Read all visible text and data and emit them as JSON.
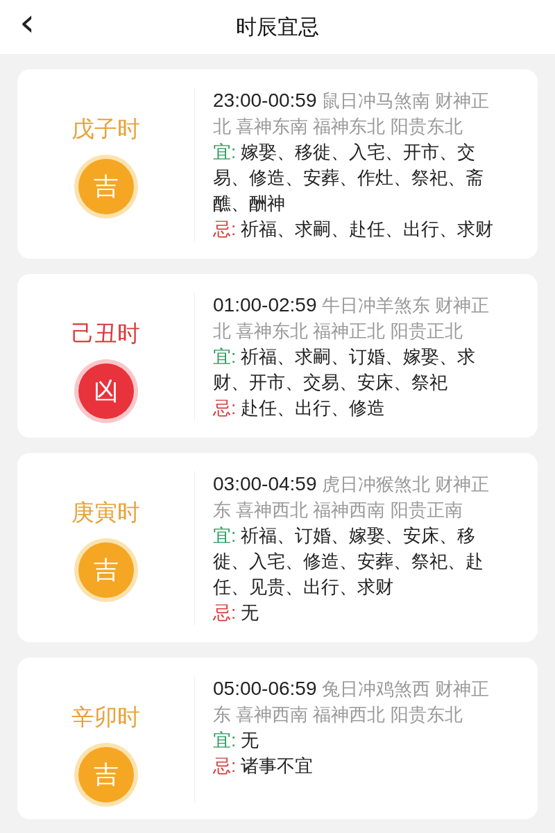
{
  "header": {
    "back_icon": "‹",
    "title": "时辰宜忌"
  },
  "hours": [
    {
      "name": "戊子时",
      "unlucky": false,
      "badge": "吉",
      "time": "23:00-00:59",
      "info": "鼠日冲马煞南 财神正北 喜神东南 福神东北 阳贵东北",
      "yi_label": "宜:",
      "yi": "嫁娶、移徙、入宅、开市、交易、修造、安葬、作灶、祭祀、斋醮、酬神",
      "ji_label": "忌:",
      "ji": "祈福、求嗣、赴任、出行、求财"
    },
    {
      "name": "己丑时",
      "unlucky": true,
      "badge": "凶",
      "time": "01:00-02:59",
      "info": "牛日冲羊煞东 财神正北 喜神东北 福神正北 阳贵正北",
      "yi_label": "宜:",
      "yi": "祈福、求嗣、订婚、嫁娶、求财、开市、交易、安床、祭祀",
      "ji_label": "忌:",
      "ji": "赴任、出行、修造"
    },
    {
      "name": "庚寅时",
      "unlucky": false,
      "badge": "吉",
      "time": "03:00-04:59",
      "info": "虎日冲猴煞北 财神正东 喜神西北 福神西南 阳贵正南",
      "yi_label": "宜:",
      "yi": "祈福、订婚、嫁娶、安床、移徙、入宅、修造、安葬、祭祀、赴任、见贵、出行、求财",
      "ji_label": "忌:",
      "ji": "无"
    },
    {
      "name": "辛卯时",
      "unlucky": false,
      "badge": "吉",
      "time": "05:00-06:59",
      "info": "兔日冲鸡煞西 财神正东 喜神西南 福神西北 阳贵东北",
      "yi_label": "宜:",
      "yi": "无",
      "ji_label": "忌:",
      "ji": "诸事不宜"
    }
  ]
}
